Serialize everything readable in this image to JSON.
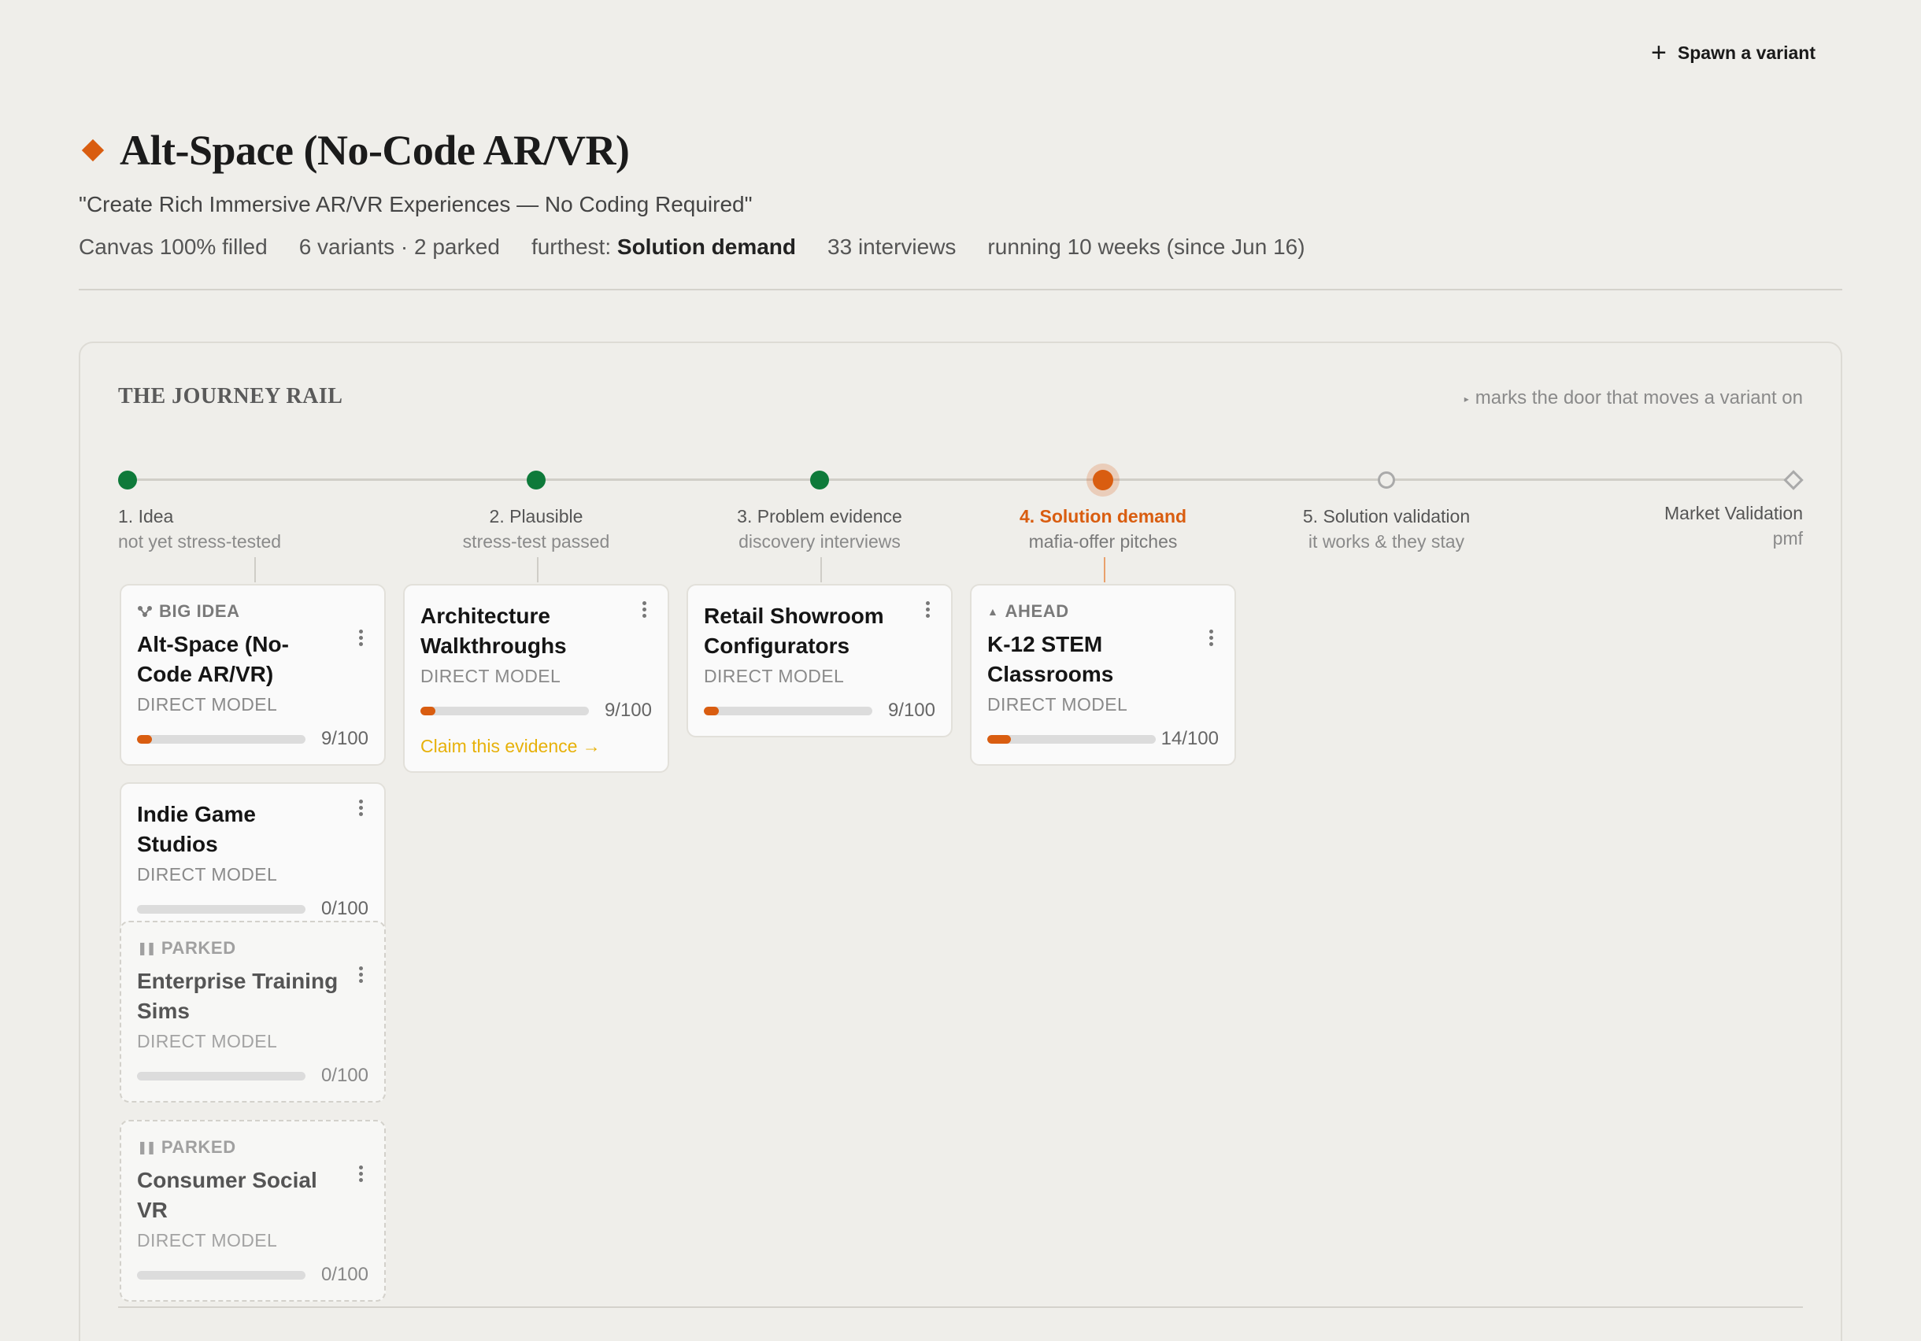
{
  "topbar": {
    "spawn_label": "Spawn a variant"
  },
  "header": {
    "title": "Alt-Space (No-Code AR/VR)",
    "tagline": "\"Create Rich Immersive AR/VR Experiences — No Coding Required\"",
    "meta": {
      "canvas": "Canvas 100% filled",
      "variants": "6 variants · 2 parked",
      "furthest_prefix": "furthest:",
      "furthest_value": "Solution demand",
      "interviews": "33 interviews",
      "running": "running 10 weeks (since Jun 16)"
    }
  },
  "journey": {
    "title": "THE JOURNEY RAIL",
    "note": "marks the door that moves a variant on",
    "stages": [
      {
        "label": "1. Idea",
        "sub": "not yet stress-tested",
        "state": "done"
      },
      {
        "label": "2. Plausible",
        "sub": "stress-test passed",
        "state": "done"
      },
      {
        "label": "3. Problem evidence",
        "sub": "discovery interviews",
        "state": "done"
      },
      {
        "label": "4. Solution demand",
        "sub": "mafia-offer pitches",
        "state": "current"
      },
      {
        "label": "5. Solution validation",
        "sub": "it works & they stay",
        "state": "open"
      },
      {
        "label": "Market Validation",
        "sub": "pmf",
        "state": "end"
      }
    ]
  },
  "cards": [
    {
      "kicker": "BIG IDEA",
      "name": "Alt-Space (No-Code AR/VR)",
      "model": "DIRECT MODEL",
      "score": "9/100",
      "progress": 0.09
    },
    {
      "kicker": "",
      "name": "Indie Game Studios",
      "model": "DIRECT MODEL",
      "score": "0/100",
      "progress": 0
    },
    {
      "kicker": "PARKED",
      "name": "Enterprise Training Sims",
      "model": "DIRECT MODEL",
      "score": "0/100",
      "progress": 0
    },
    {
      "kicker": "PARKED",
      "name": "Consumer Social VR",
      "model": "DIRECT MODEL",
      "score": "0/100",
      "progress": 0
    },
    {
      "kicker": "",
      "name": "Architecture Walkthroughs",
      "model": "DIRECT MODEL",
      "score": "9/100",
      "progress": 0.09,
      "action": "Claim this evidence →"
    },
    {
      "kicker": "",
      "name": "Retail Showroom Configurators",
      "model": "DIRECT MODEL",
      "score": "9/100",
      "progress": 0.09
    },
    {
      "kicker": "AHEAD",
      "name": "K-12 STEM Classrooms",
      "model": "DIRECT MODEL",
      "score": "14/100",
      "progress": 0.14
    }
  ],
  "colors": {
    "accent": "#d95d10",
    "done": "#0e7a3a",
    "claim": "#e7b10a",
    "background": "#efeeea"
  }
}
